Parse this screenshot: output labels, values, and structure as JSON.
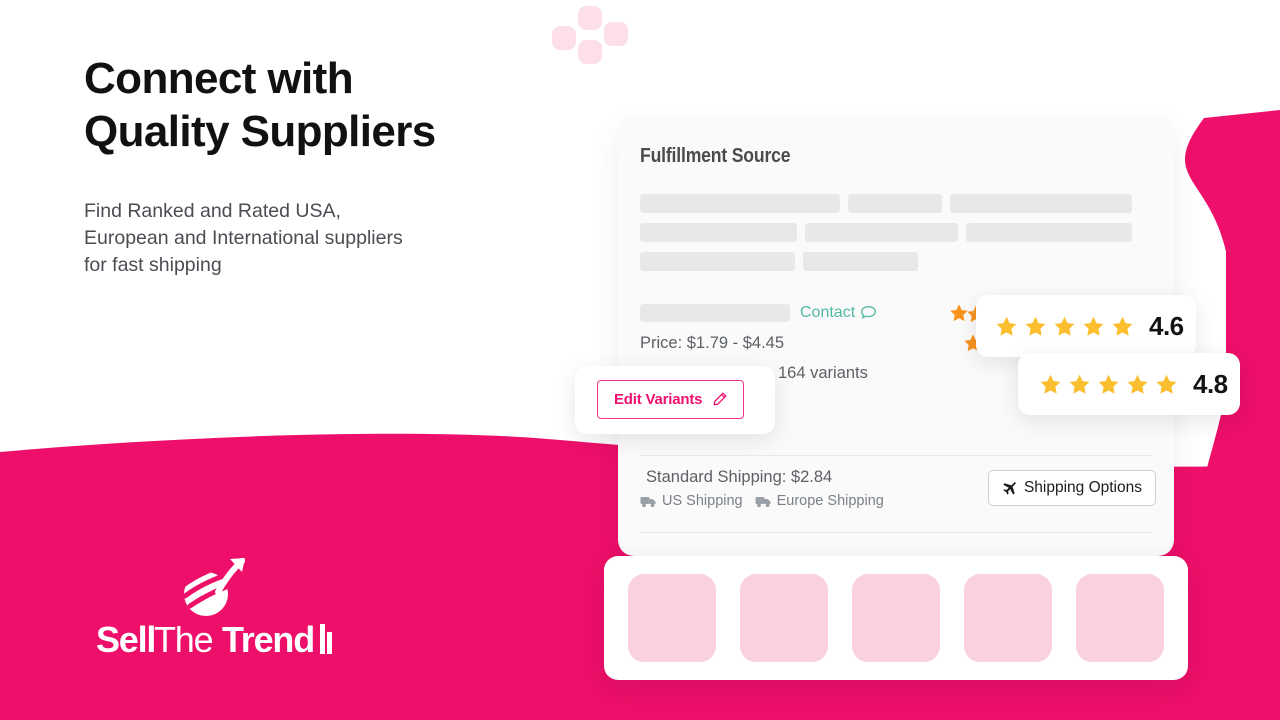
{
  "theme": {
    "brand_pink": "#ED0F69",
    "brand_pink_light": "#FBD0E1",
    "dot_pink": "#FCDFE9",
    "teal": "#52B8A3",
    "star_gold": "#FBBE2E",
    "star_orange": "#F7941E",
    "skeleton_grey": "#E8E8E8",
    "card_bg": "#FAFAFA",
    "text_dark": "#111114",
    "text_muted": "#5D6166"
  },
  "hero": {
    "headline_line1": "Connect with",
    "headline_line2": "Quality Suppliers",
    "subhead_line1": "Find Ranked and Rated USA,",
    "subhead_line2": "European and International suppliers",
    "subhead_line3": "for fast shipping"
  },
  "logo": {
    "brand_name": "SellTheTrend",
    "word_part1": "Sell",
    "word_part2": "The",
    "word_part3": "Trend",
    "mark_icon": "globe-swoosh-icon"
  },
  "card": {
    "title": "Fulfillment Source",
    "skeleton_rows": [
      [
        200,
        94,
        222
      ],
      [
        157,
        153,
        142
      ],
      [
        155,
        115
      ]
    ],
    "contact": {
      "label": "Contact",
      "icon": "speech-bubble-icon"
    },
    "price_label": "Price: $1.79 - $4.45",
    "variants_label": "164 variants",
    "shipping": {
      "standard_label": "Standard Shipping: $2.84",
      "tags": [
        {
          "label": "US Shipping",
          "icon": "truck-icon"
        },
        {
          "label": "Europe Shipping",
          "icon": "truck-icon"
        }
      ],
      "options_button": "Shipping Options",
      "options_icon": "airplane-icon"
    }
  },
  "edit_variants": {
    "label": "Edit Variants",
    "icon": "pencil-icon"
  },
  "ratings": [
    {
      "value": "4.6",
      "stars": 5
    },
    {
      "value": "4.8",
      "stars": 5
    }
  ],
  "thumbnails": [
    {
      "index": "1"
    },
    {
      "index": "2"
    },
    {
      "index": "3"
    },
    {
      "index": "4"
    },
    {
      "index": "5"
    }
  ],
  "decor": {
    "dots": [
      "dot-1",
      "dot-2",
      "dot-3",
      "dot-4"
    ]
  }
}
